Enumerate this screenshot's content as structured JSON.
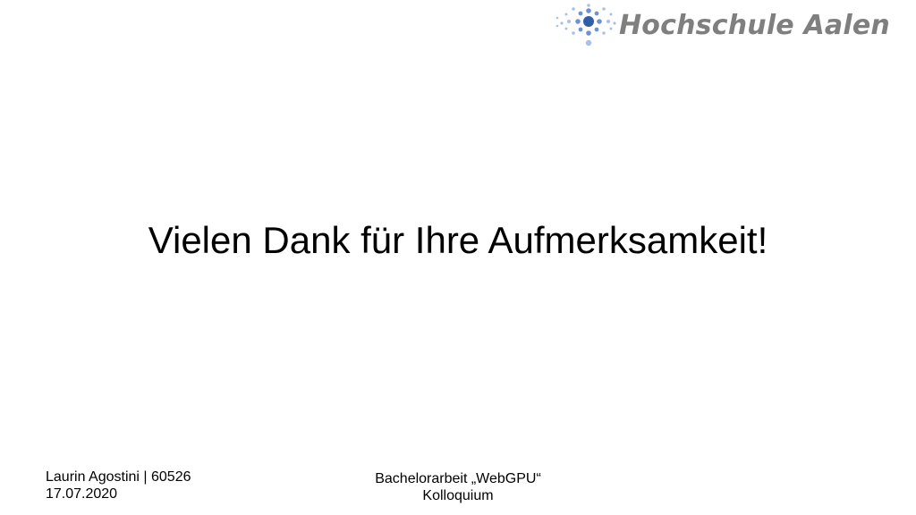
{
  "logo": {
    "text": "Hochschule Aalen",
    "text_color": "#7f7f7f",
    "mark_colors": [
      "#2f5fa8",
      "#6f93cf",
      "#a9c1e6"
    ]
  },
  "slide": {
    "title": "Vielen Dank für Ihre Aufmerksamkeit!"
  },
  "footer": {
    "author": "Laurin Agostini | 60526",
    "date": "17.07.2020",
    "thesis": "Bachelorarbeit „WebGPU“",
    "event": "Kolloquium"
  }
}
